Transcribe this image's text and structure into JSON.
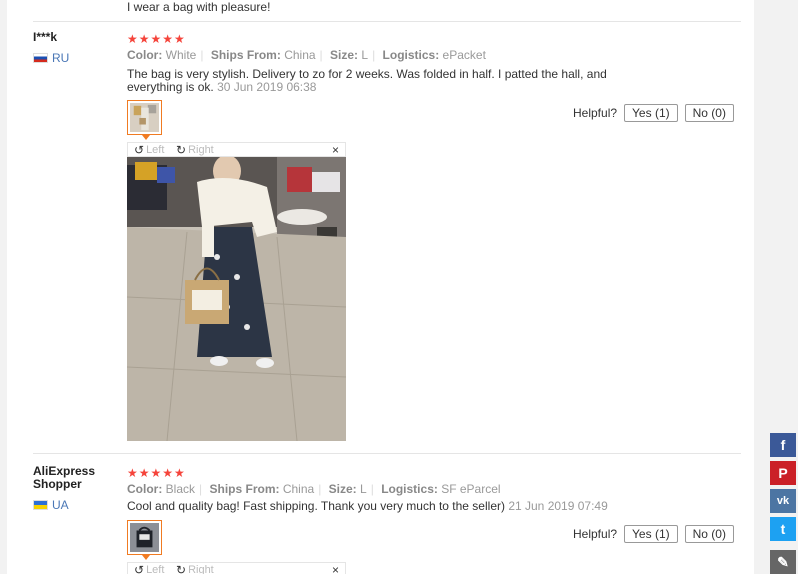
{
  "prev_review": {
    "text": "I wear a bag with pleasure!"
  },
  "reviews": [
    {
      "user": "I***k",
      "country": "RU",
      "stars": "★★★★★",
      "meta": {
        "color_label": "Color:",
        "color": "White",
        "ships_label": "Ships From:",
        "ships": "China",
        "size_label": "Size:",
        "size": "L",
        "logistics_label": "Logistics:",
        "logistics": "ePacket"
      },
      "text": "The bag is very stylish. Delivery to zo for 2 weeks. Was folded in half. I patted the hall, and everything is ok.",
      "date": "30 Jun 2019 06:38",
      "helpful_label": "Helpful?",
      "yes": "Yes (1)",
      "no": "No (0)",
      "viewer": {
        "left": "Left",
        "right": "Right",
        "close": "×"
      }
    },
    {
      "user": "AliExpress Shopper",
      "country": "UA",
      "stars": "★★★★★",
      "meta": {
        "color_label": "Color:",
        "color": "Black",
        "ships_label": "Ships From:",
        "ships": "China",
        "size_label": "Size:",
        "size": "L",
        "logistics_label": "Logistics:",
        "logistics": "SF eParcel"
      },
      "text": "Cool and quality bag! Fast shipping. Thank you very much to the seller)",
      "date": "21 Jun 2019 07:49",
      "helpful_label": "Helpful?",
      "yes": "Yes (1)",
      "no": "No (0)",
      "viewer": {
        "left": "Left",
        "right": "Right",
        "close": "×"
      }
    }
  ],
  "share": {
    "facebook": "f",
    "pinterest": "P",
    "vk": "vk",
    "twitter": "t",
    "edit": "✎",
    "colors": {
      "facebook": "#3b5998",
      "pinterest": "#cb2027",
      "vk": "#4c75a3",
      "twitter": "#1da1f2",
      "edit": "#666666"
    }
  },
  "colors": {
    "accent": "#f07b22",
    "star": "#f5443b",
    "country_link": "#4a77b6"
  }
}
